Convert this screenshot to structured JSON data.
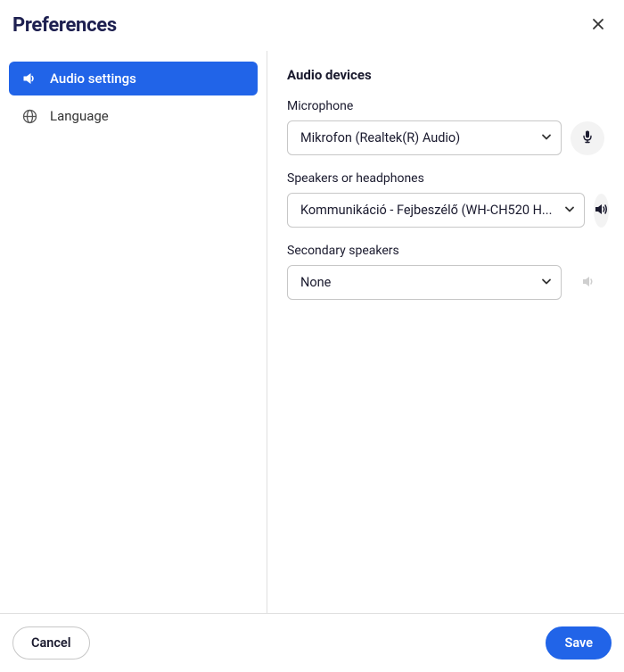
{
  "header": {
    "title": "Preferences"
  },
  "sidebar": {
    "items": [
      {
        "label": "Audio settings",
        "active": true
      },
      {
        "label": "Language",
        "active": false
      }
    ]
  },
  "content": {
    "section_title": "Audio devices",
    "microphone": {
      "label": "Microphone",
      "value": "Mikrofon (Realtek(R) Audio)"
    },
    "speakers": {
      "label": "Speakers or headphones",
      "value": "Kommunikáció - Fejbeszélő (WH-CH520 H..."
    },
    "secondary": {
      "label": "Secondary speakers",
      "value": "None"
    }
  },
  "footer": {
    "cancel_label": "Cancel",
    "save_label": "Save"
  }
}
